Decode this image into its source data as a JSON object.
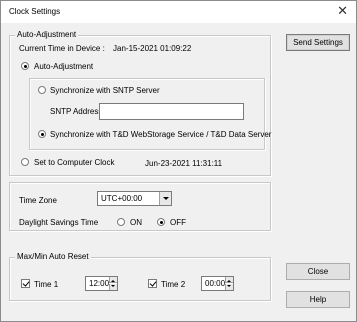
{
  "window": {
    "title": "Clock Settings",
    "close_glyph": "✕"
  },
  "auto_adjustment": {
    "legend": "Auto-Adjustment",
    "current_time_label": "Current Time in Device :",
    "current_time_value": "Jan-15-2021 01:09:22",
    "auto_radio_label": "Auto-Adjustment",
    "sntp_radio_label": "Synchronize with SNTP Server",
    "sntp_address_label": "SNTP Address",
    "sntp_address_value": "",
    "td_radio_label": "Synchronize with T&D WebStorage Service / T&D Data Server",
    "computer_clock_label": "Set to Computer Clock",
    "computer_clock_value": "Jun-23-2021 11:31:11",
    "selected_mode": "auto-adjustment",
    "selected_sync": "td"
  },
  "time_zone": {
    "label": "Time Zone",
    "value": "UTC+00:00",
    "dst_label": "Daylight Savings Time",
    "on_label": "ON",
    "off_label": "OFF",
    "dst_selected": "OFF"
  },
  "auto_reset": {
    "legend": "Max/Min Auto Reset",
    "time1_label": "Time 1",
    "time1_checked": true,
    "time1_value": "12:00",
    "time2_label": "Time 2",
    "time2_checked": true,
    "time2_value": "00:00"
  },
  "buttons": {
    "send_settings": "Send Settings",
    "close": "Close",
    "help": "Help"
  }
}
